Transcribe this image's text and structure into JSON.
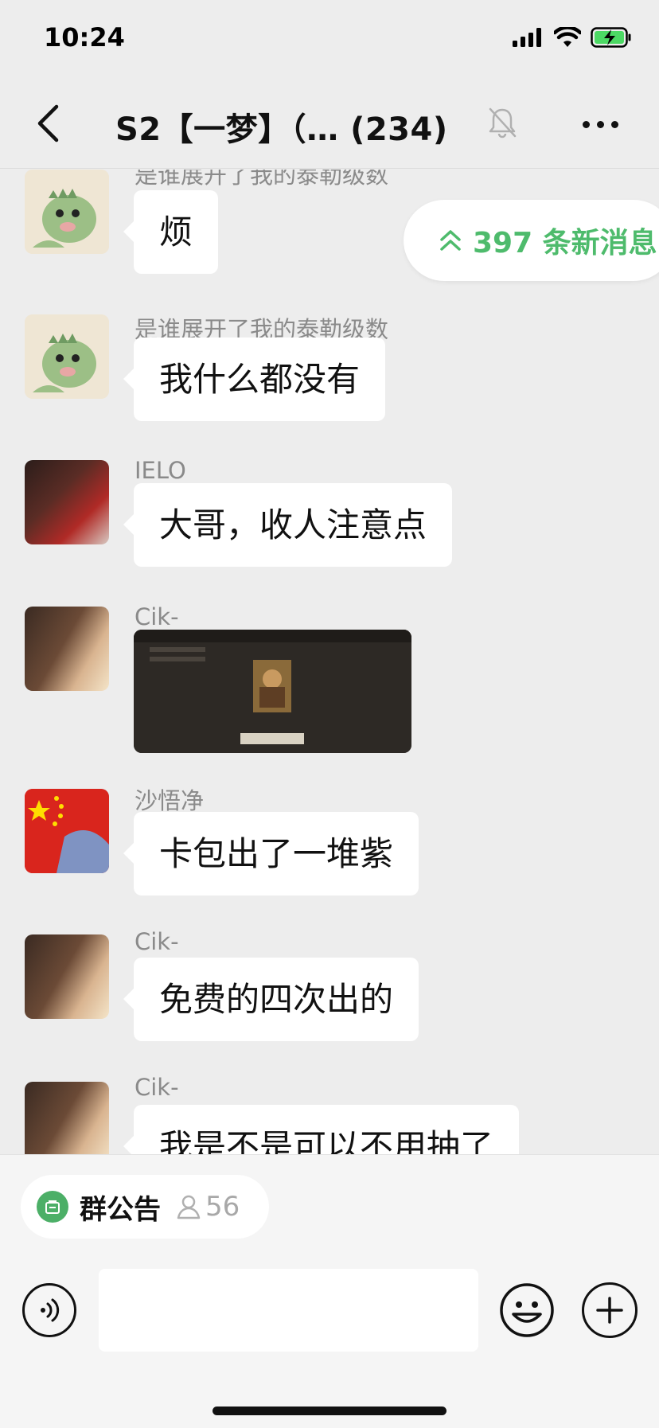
{
  "status_bar": {
    "time": "10:24"
  },
  "header": {
    "title": "S2【一梦】（…  (234)"
  },
  "new_messages": {
    "label": "397 条新消息"
  },
  "messages": [
    {
      "sender": "是谁展开了我的泰勒级数",
      "text": "烦",
      "avatar": "dinosaur-avatar"
    },
    {
      "sender": "是谁展开了我的泰勒级数",
      "text": "我什么都没有",
      "avatar": "dinosaur-avatar"
    },
    {
      "sender": "IELO",
      "text": "大哥，收人注意点",
      "avatar": "player-avatar"
    },
    {
      "sender": "Cik-",
      "text": "",
      "avatar": "portrait-avatar",
      "image": "game-screenshot"
    },
    {
      "sender": "沙悟净",
      "text": "卡包出了一堆紫",
      "avatar": "flag-avatar"
    },
    {
      "sender": "Cik-",
      "text": "免费的四次出的",
      "avatar": "portrait-avatar"
    },
    {
      "sender": "Cik-",
      "text": "我是不是可以不用抽了",
      "avatar": "portrait-avatar"
    }
  ],
  "footer": {
    "notice_label": "群公告",
    "member_count": "56"
  },
  "colors": {
    "accent_green": "#4ebb6c",
    "background": "#ededed",
    "bubble": "#ffffff"
  }
}
